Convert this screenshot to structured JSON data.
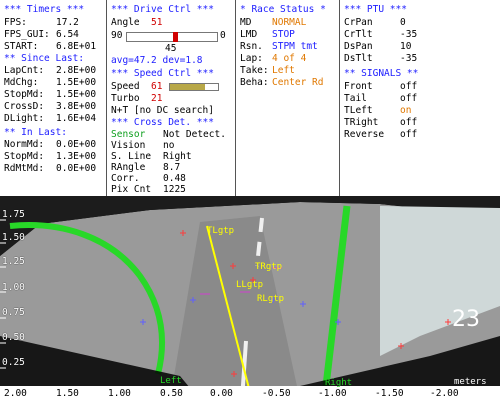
{
  "timers": {
    "header": "*** Timers ***",
    "fps": {
      "label": "FPS:",
      "value": "17.2"
    },
    "fps_gui": {
      "label": "FPS_GUI:",
      "value": "6.54"
    },
    "start": {
      "label": "START:",
      "value": "6.8E+01"
    },
    "since_last_header": "** Since Last:",
    "since_last": [
      {
        "label": "LapCnt:",
        "value": "2.8E+00"
      },
      {
        "label": "MdChg:",
        "value": "1.5E+00"
      },
      {
        "label": "StopMd:",
        "value": "1.5E+00"
      },
      {
        "label": "CrossD:",
        "value": "3.8E+00"
      },
      {
        "label": "DLight:",
        "value": "1.6E+04"
      }
    ],
    "in_last_header": "** In Last:",
    "in_last": [
      {
        "label": "NormMd:",
        "value": "0.0E+00"
      },
      {
        "label": "StopMd:",
        "value": "1.3E+00"
      },
      {
        "label": "RdMtMd:",
        "value": "0.0E+00"
      }
    ]
  },
  "drive": {
    "header": "*** Drive Ctrl ***",
    "angle_label": "Angle",
    "angle_value": "51",
    "slider_min": "90",
    "slider_max": "0",
    "slider_center": "45",
    "slider_fraction": 0.51,
    "avg_dev": "avg=47.2 dev=1.8"
  },
  "speed": {
    "header": "*** Speed Ctrl ***",
    "speed_label": "Speed",
    "speed_value": "61",
    "turbo_label": "Turbo",
    "turbo_value": "21"
  },
  "cross": {
    "header": "*** Cross Det. ***",
    "rows": [
      {
        "label": "Sensor",
        "value": "Not Detect.",
        "label_color": "#10a020"
      },
      {
        "label": "Vision",
        "value": "no"
      },
      {
        "label": "S. Line",
        "value": "Right"
      },
      {
        "label": "RAngle",
        "value": "8.7"
      },
      {
        "label": "Corr.",
        "value": "0.48"
      },
      {
        "label": "Pix Cnt",
        "value": "1225"
      }
    ],
    "note": "N+T [no DC search]"
  },
  "race": {
    "header": "* Race Status *",
    "rows": [
      {
        "label": "MD",
        "value": "NORMAL",
        "color": "#e07800"
      },
      {
        "label": "LMD",
        "value": "STOP",
        "color": "#2020ff"
      },
      {
        "label": "Rsn.",
        "value": "STPM tmt",
        "color": "#2020ff"
      },
      {
        "label": "Lap:",
        "value": "4 of 4",
        "color": "#e07800"
      },
      {
        "label": "Take:",
        "value": "Left",
        "color": "#e07800"
      },
      {
        "label": "Beha:",
        "value": "Center Rd",
        "color": "#e07800"
      }
    ]
  },
  "ptu": {
    "header": "*** PTU ***",
    "rows": [
      {
        "label": "CrPan",
        "value": "0"
      },
      {
        "label": "CrTlt",
        "value": "-35"
      },
      {
        "label": "DsPan",
        "value": "10"
      },
      {
        "label": "DsTlt",
        "value": "-35"
      }
    ]
  },
  "signals": {
    "header": "** SIGNALS **",
    "rows": [
      {
        "label": "Front",
        "value": "off",
        "color": "#000"
      },
      {
        "label": "Tail",
        "value": "off",
        "color": "#000"
      },
      {
        "label": "TLeft",
        "value": "on",
        "color": "#e07800"
      },
      {
        "label": "TRight",
        "value": "off",
        "color": "#000"
      },
      {
        "label": "Reverse",
        "value": "off",
        "color": "#000"
      }
    ]
  },
  "overlay": {
    "labels": [
      {
        "text": "TLgtp",
        "color": "#ffff00",
        "name": "label-tlgtp"
      },
      {
        "text": "TRgtp",
        "color": "#ffff00",
        "name": "label-trgtp"
      },
      {
        "text": "LLgtp",
        "color": "#ffff00",
        "name": "label-llgtp"
      },
      {
        "text": "RLgtp",
        "color": "#ffff00",
        "name": "label-rlgtp"
      },
      {
        "text": "Left",
        "color": "#28d828",
        "name": "label-left"
      },
      {
        "text": "Right",
        "color": "#28d828",
        "name": "label-right"
      },
      {
        "text": "meters",
        "color": "#000",
        "name": "label-meters"
      }
    ]
  },
  "axes": {
    "y": [
      "1.75",
      "1.50",
      "1.25",
      "1.00",
      "0.75",
      "0.50",
      "0.25"
    ],
    "x": [
      "2.00",
      "1.50",
      "1.00",
      "0.50",
      "0.00",
      "-0.50",
      "-1.00",
      "-1.50",
      "-2.00"
    ]
  }
}
